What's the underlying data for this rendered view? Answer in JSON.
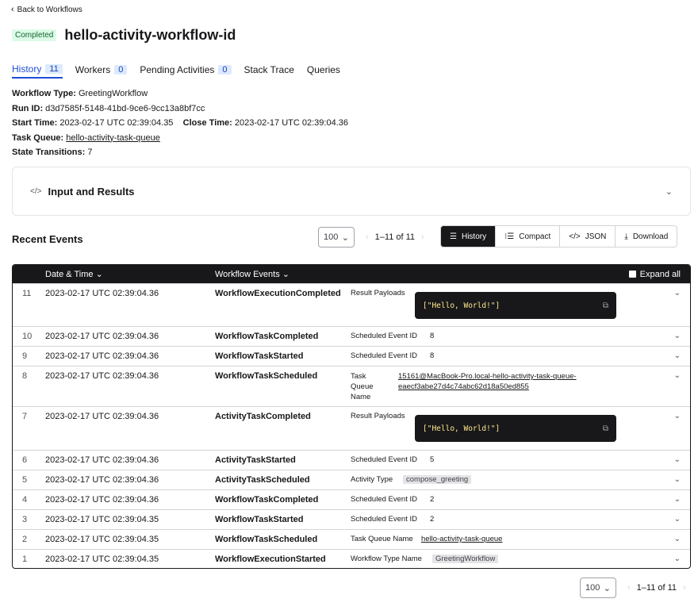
{
  "nav": {
    "back_label": "Back to Workflows"
  },
  "workflow": {
    "status": "Completed",
    "id": "hello-activity-workflow-id"
  },
  "tabs": [
    {
      "label": "History",
      "count": "11"
    },
    {
      "label": "Workers",
      "count": "0"
    },
    {
      "label": "Pending Activities",
      "count": "0"
    },
    {
      "label": "Stack Trace"
    },
    {
      "label": "Queries"
    }
  ],
  "meta": {
    "type_label": "Workflow Type:",
    "type": "GreetingWorkflow",
    "run_label": "Run ID:",
    "run_id": "d3d7585f-5148-41bd-9ce6-9cc13a8bf7cc",
    "start_label": "Start Time:",
    "start": "2023-02-17 UTC 02:39:04.35",
    "close_label": "Close Time:",
    "close": "2023-02-17 UTC 02:39:04.36",
    "queue_label": "Task Queue:",
    "queue": "hello-activity-task-queue",
    "transitions_label": "State Transitions:",
    "transitions": "7"
  },
  "input_results": {
    "title": "Input and Results"
  },
  "recent": {
    "title": "Recent Events",
    "page_size": "100",
    "page_info": "1–11 of 11",
    "views": [
      "History",
      "Compact",
      "JSON"
    ],
    "download_label": "Download"
  },
  "table": {
    "headers": {
      "date": "Date & Time",
      "events": "Workflow Events",
      "expand": "Expand all"
    },
    "rows": [
      {
        "num": "11",
        "date": "2023-02-17 UTC 02:39:04.36",
        "event": "WorkflowExecutionCompleted",
        "key": "Result Payloads",
        "code": "[\"Hello, World!\"]"
      },
      {
        "num": "10",
        "date": "2023-02-17 UTC 02:39:04.36",
        "event": "WorkflowTaskCompleted",
        "key": "Scheduled Event ID",
        "value": "8"
      },
      {
        "num": "9",
        "date": "2023-02-17 UTC 02:39:04.36",
        "event": "WorkflowTaskStarted",
        "key": "Scheduled Event ID",
        "value": "8"
      },
      {
        "num": "8",
        "date": "2023-02-17 UTC 02:39:04.36",
        "event": "WorkflowTaskScheduled",
        "key_lines": [
          "Task",
          "Queue",
          "Name"
        ],
        "value_lines": [
          "15161@MacBook-Pro.local-hello-activity-task-queue-",
          "eaecf3abe27d4c74abc62d18a50ed855"
        ]
      },
      {
        "num": "7",
        "date": "2023-02-17 UTC 02:39:04.36",
        "event": "ActivityTaskCompleted",
        "key": "Result Payloads",
        "code": "[\"Hello, World!\"]"
      },
      {
        "num": "6",
        "date": "2023-02-17 UTC 02:39:04.36",
        "event": "ActivityTaskStarted",
        "key": "Scheduled Event ID",
        "value": "5"
      },
      {
        "num": "5",
        "date": "2023-02-17 UTC 02:39:04.36",
        "event": "ActivityTaskScheduled",
        "key": "Activity Type",
        "value": "compose_greeting"
      },
      {
        "num": "4",
        "date": "2023-02-17 UTC 02:39:04.36",
        "event": "WorkflowTaskCompleted",
        "key": "Scheduled Event ID",
        "value": "2"
      },
      {
        "num": "3",
        "date": "2023-02-17 UTC 02:39:04.35",
        "event": "WorkflowTaskStarted",
        "key": "Scheduled Event ID",
        "value": "2"
      },
      {
        "num": "2",
        "date": "2023-02-17 UTC 02:39:04.35",
        "event": "WorkflowTaskScheduled",
        "key": "Task Queue Name",
        "value": "hello-activity-task-queue"
      },
      {
        "num": "1",
        "date": "2023-02-17 UTC 02:39:04.35",
        "event": "WorkflowExecutionStarted",
        "key": "Workflow Type Name",
        "value": "GreetingWorkflow"
      }
    ]
  },
  "footer": {
    "page_size": "100",
    "page_info": "1–11 of 11"
  },
  "colors": {
    "accent": "#1d4ed8",
    "dark": "#18181b",
    "completed_bg": "#dcfce7",
    "completed_text": "#166534"
  }
}
